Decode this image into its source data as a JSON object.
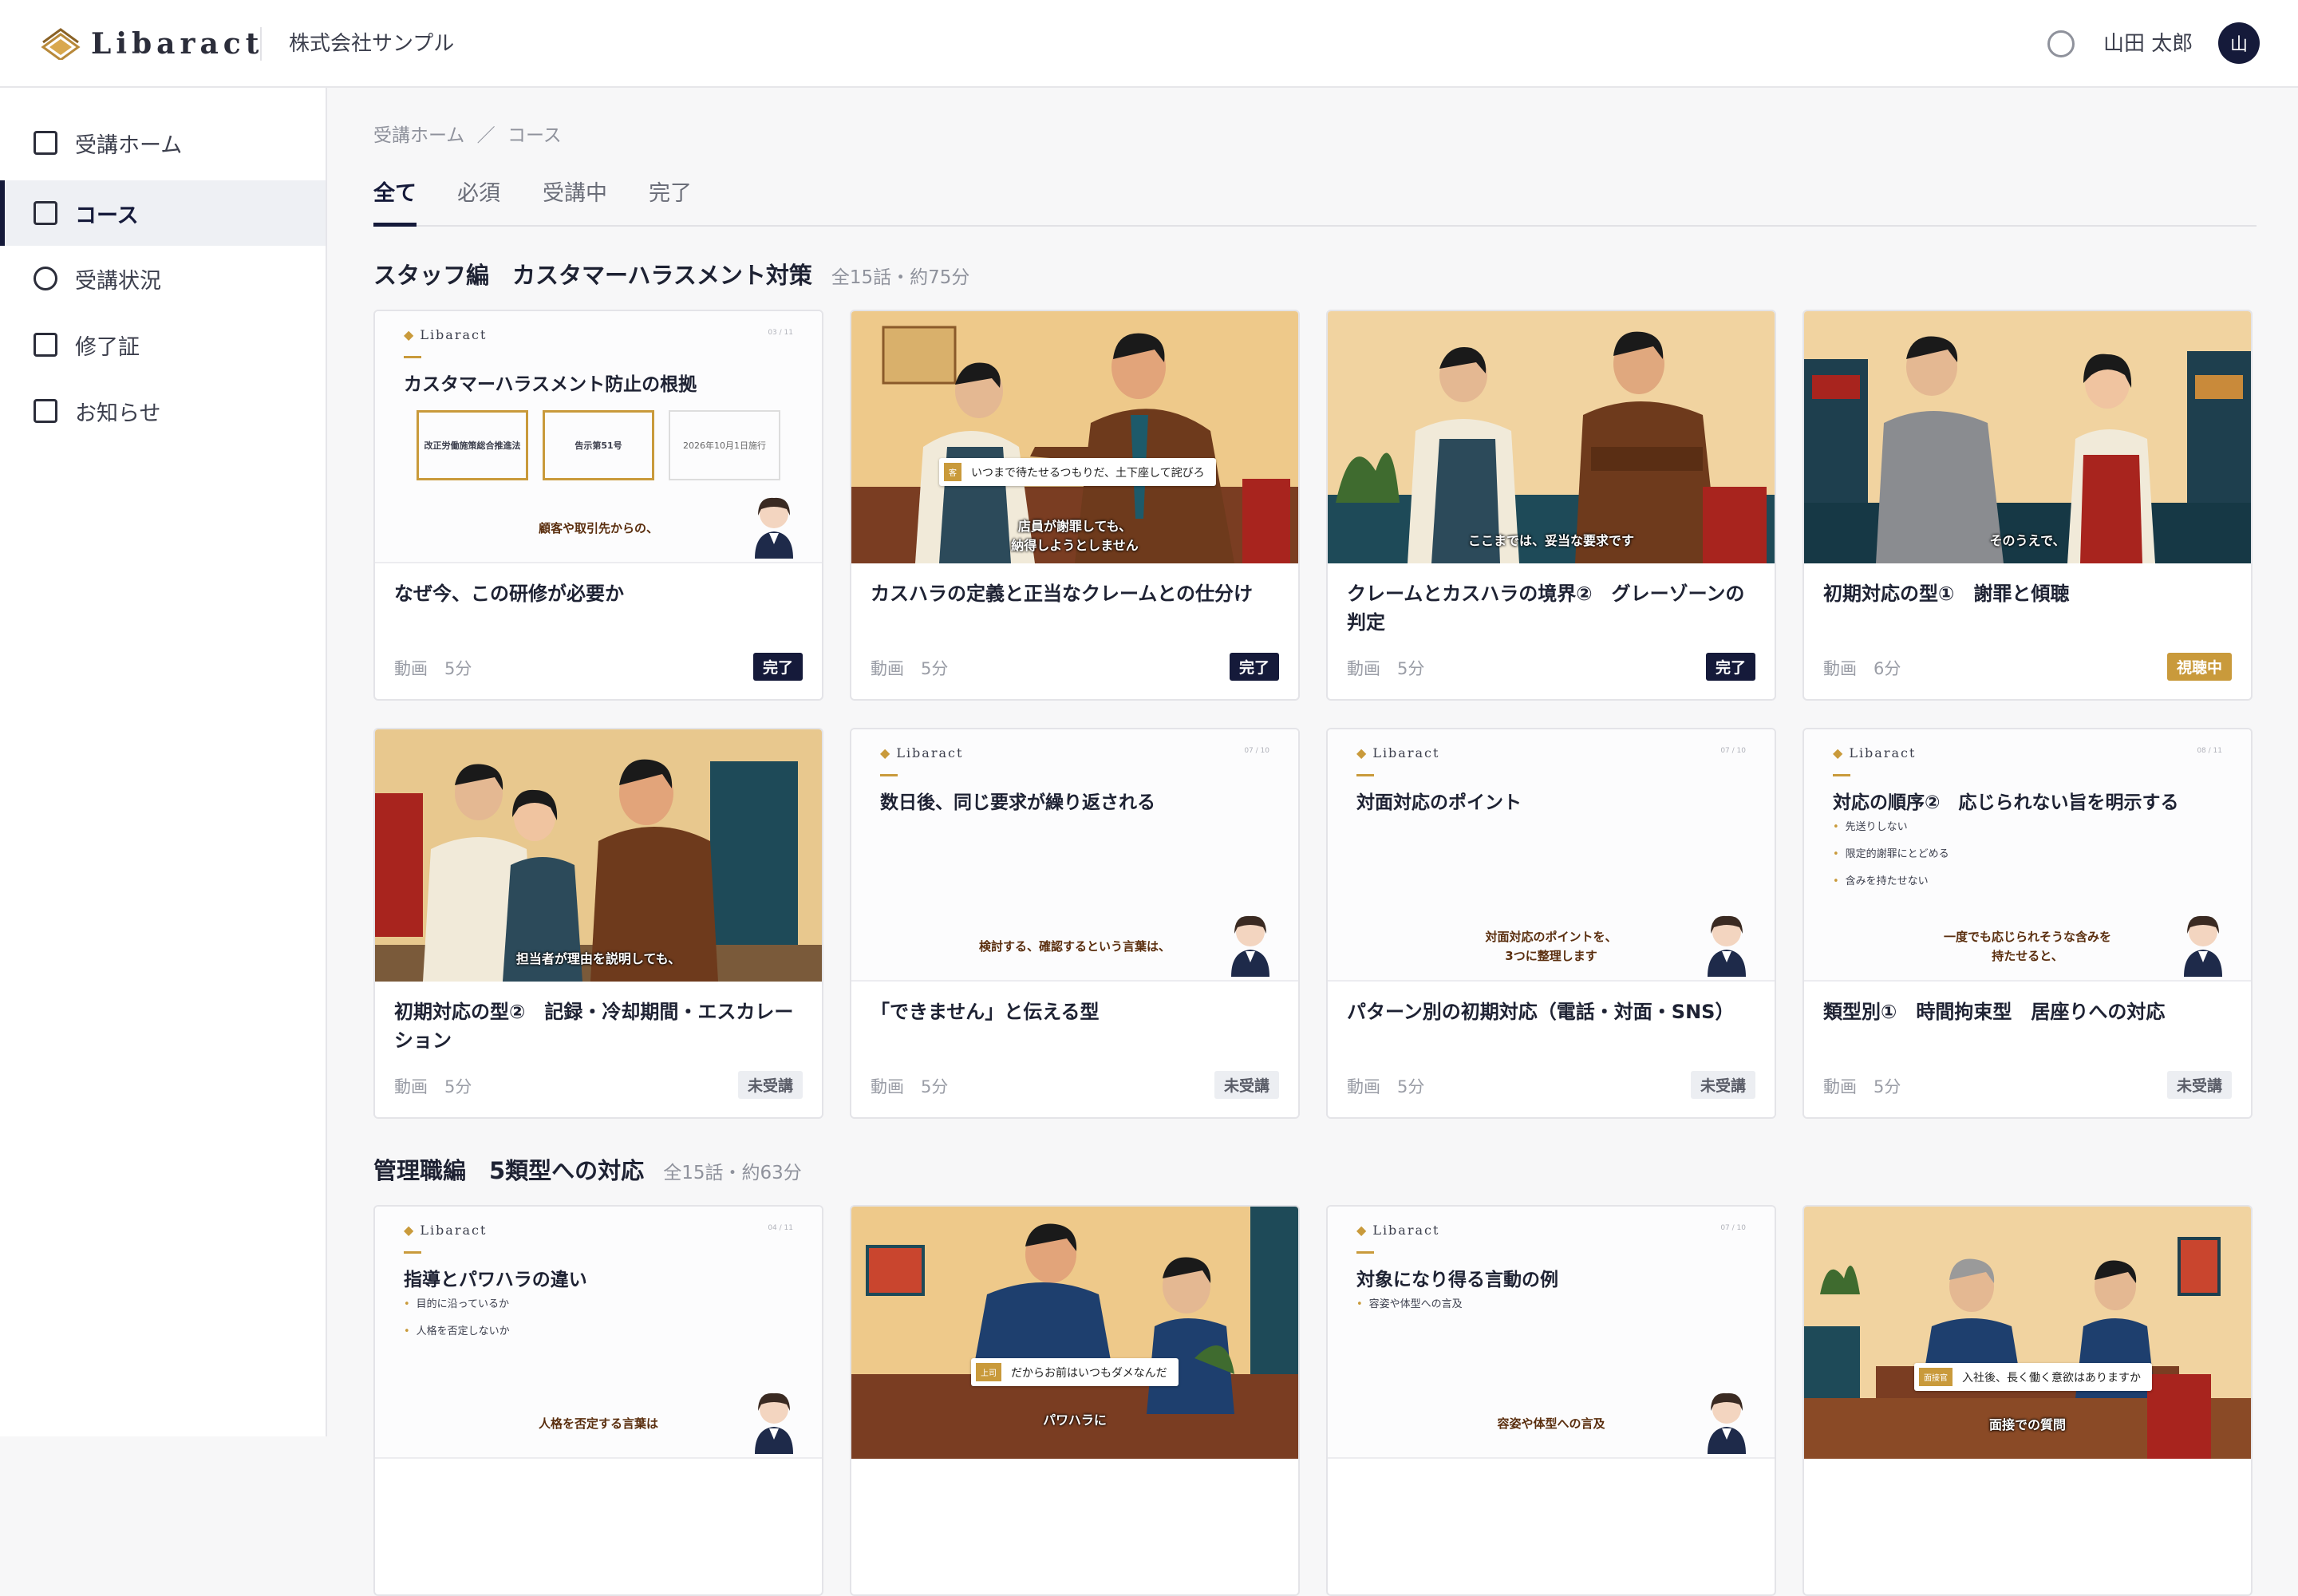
{
  "header": {
    "logo_text": "Libaract",
    "company": "株式会社サンプル",
    "user_name": "山田 太郎",
    "avatar_initial": "山"
  },
  "sidebar": {
    "items": [
      {
        "label": "受講ホーム",
        "icon": "square-icon",
        "active": false
      },
      {
        "label": "コース",
        "icon": "square-icon",
        "active": true
      },
      {
        "label": "受講状況",
        "icon": "circle-icon",
        "active": false
      },
      {
        "label": "修了証",
        "icon": "square-icon",
        "active": false
      },
      {
        "label": "お知らせ",
        "icon": "square-icon",
        "active": false
      }
    ]
  },
  "breadcrumb": {
    "home": "受講ホーム",
    "sep": "／",
    "current": "コース"
  },
  "tabs": [
    {
      "label": "全て",
      "active": true
    },
    {
      "label": "必須",
      "active": false
    },
    {
      "label": "受講中",
      "active": false
    },
    {
      "label": "完了",
      "active": false
    }
  ],
  "sections": [
    {
      "title": "スタッフ編　カスタマーハラスメント対策",
      "meta": "全15話・約75分",
      "cards": [
        {
          "title": "なぜ今、この研修が必要か",
          "meta": "動画　5分",
          "badge": "完了",
          "thumb": {
            "kind": "slide",
            "logo": "Libaract",
            "page": "03 / 11",
            "heading": "カスタマーハラスメント防止の根拠",
            "boxes": [
              "改正労働施策総合推進法",
              "告示第51号",
              "2026年10月1日施行"
            ],
            "caption": "顧客や取引先からの、"
          }
        },
        {
          "title": "カスハラの定義と正当なクレームとの仕分け",
          "meta": "動画　5分",
          "badge": "完了",
          "thumb": {
            "kind": "photo",
            "subtitle_tag": "客",
            "subtitle": "いつまで待たせるつもりだ、土下座して詫びろ",
            "caption_1": "店員が謝罪しても、",
            "caption_2": "納得しようとしません"
          }
        },
        {
          "title": "クレームとカスハラの境界②　グレーゾーンの判定",
          "meta": "動画　5分",
          "badge": "完了",
          "thumb": {
            "kind": "photo",
            "caption_1": "ここまでは、妥当な要求です"
          }
        },
        {
          "title": "初期対応の型①　謝罪と傾聴",
          "meta": "動画　6分",
          "badge": "視聴中",
          "thumb": {
            "kind": "photo",
            "caption_1": "そのうえで、"
          }
        },
        {
          "title": "初期対応の型②　記録・冷却期間・エスカレーション",
          "meta": "動画　5分",
          "badge": "未受講",
          "thumb": {
            "kind": "photo",
            "caption_1": "担当者が理由を説明しても、"
          }
        },
        {
          "title": "「できません」と伝える型",
          "meta": "動画　5分",
          "badge": "未受講",
          "thumb": {
            "kind": "slide",
            "logo": "Libaract",
            "page": "07 / 10",
            "heading": "数日後、同じ要求が繰り返される",
            "caption": "検討する、確認するという言葉は、"
          }
        },
        {
          "title": "パターン別の初期対応（電話・対面・SNS）",
          "meta": "動画　5分",
          "badge": "未受講",
          "thumb": {
            "kind": "slide",
            "logo": "Libaract",
            "page": "07 / 10",
            "heading": "対面対応のポイント",
            "caption_1": "対面対応のポイントを、",
            "caption_2": "3つに整理します"
          }
        },
        {
          "title": "類型別①　時間拘束型　居座りへの対応",
          "meta": "動画　5分",
          "badge": "未受講",
          "thumb": {
            "kind": "slide",
            "logo": "Libaract",
            "page": "08 / 11",
            "heading": "対応の順序②　応じられない旨を明示する",
            "bullets": [
              "先送りしない",
              "限定的謝罪にとどめる",
              "含みを持たせない"
            ],
            "caption_1": "一度でも応じられそうな含みを",
            "caption_2": "持たせると、"
          }
        }
      ]
    },
    {
      "title": "管理職編　5類型への対応",
      "meta": "全15話・約63分",
      "cards": [
        {
          "thumb": {
            "kind": "slide",
            "logo": "Libaract",
            "page": "04 / 11",
            "heading": "指導とパワハラの違い",
            "bullets": [
              "目的に沿っているか",
              "人格を否定しないか"
            ],
            "caption": "人格を否定する言葉は"
          }
        },
        {
          "thumb": {
            "kind": "photo",
            "subtitle_tag": "上司",
            "subtitle": "だからお前はいつもダメなんだ",
            "caption_1": "パワハラに"
          }
        },
        {
          "thumb": {
            "kind": "slide",
            "logo": "Libaract",
            "page": "07 / 10",
            "heading": "対象になり得る言動の例",
            "bullets": [
              "容姿や体型への言及"
            ],
            "caption": "容姿や体型への言及"
          }
        },
        {
          "thumb": {
            "kind": "photo",
            "subtitle_tag": "面接官",
            "subtitle": "入社後、長く働く意欲はありますか",
            "caption_1": "面接での質問"
          }
        }
      ]
    }
  ]
}
